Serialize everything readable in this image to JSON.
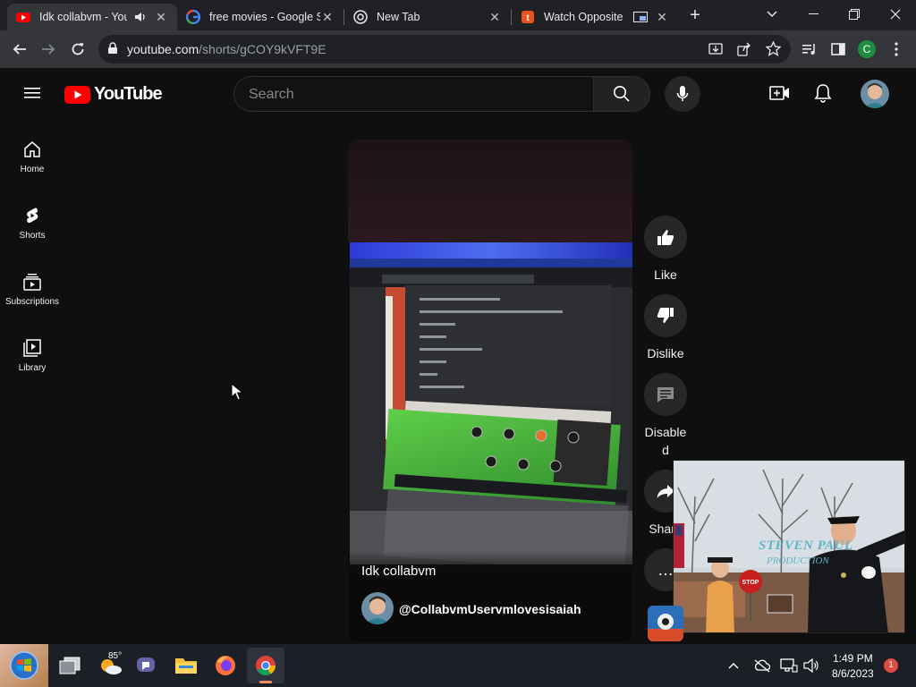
{
  "browser": {
    "tabs": [
      {
        "title": "Idk collabvm - You",
        "favicon": "youtube-icon",
        "active": true,
        "audio": true
      },
      {
        "title": "free movies - Google Se",
        "favicon": "google-icon",
        "active": false
      },
      {
        "title": "New Tab",
        "favicon": "chrome-icon",
        "active": false
      },
      {
        "title": "Watch Opposite Da",
        "favicon": "tubi-icon",
        "active": false,
        "pip": true
      }
    ],
    "url_host": "youtube.com",
    "url_path": "/shorts/gCOY9kVFT9E",
    "profile_initial": "C"
  },
  "youtube": {
    "logo_text": "YouTube",
    "search_placeholder": "Search",
    "nav": [
      {
        "label": "Home",
        "icon": "home-icon"
      },
      {
        "label": "Shorts",
        "icon": "shorts-icon"
      },
      {
        "label": "Subscriptions",
        "icon": "subscriptions-icon"
      },
      {
        "label": "Library",
        "icon": "library-icon"
      }
    ],
    "short": {
      "title": "Idk collabvm",
      "channel": "@CollabvmUservmlovesisaiah"
    },
    "actions": {
      "like": "Like",
      "dislike": "Dislike",
      "comments": "Disable\nd",
      "share": "Share",
      "more": "…"
    }
  },
  "pip": {
    "logo_line1": "STEVEN PAUL",
    "logo_line2": "PRODUCTION"
  },
  "taskbar": {
    "weather_temp": "85°",
    "time": "1:49 PM",
    "date": "8/6/2023",
    "notifications": "1"
  },
  "colors": {
    "youtube_red": "#ff0000",
    "page_bg": "#0f0f0f",
    "chrome_frame": "#202124"
  }
}
